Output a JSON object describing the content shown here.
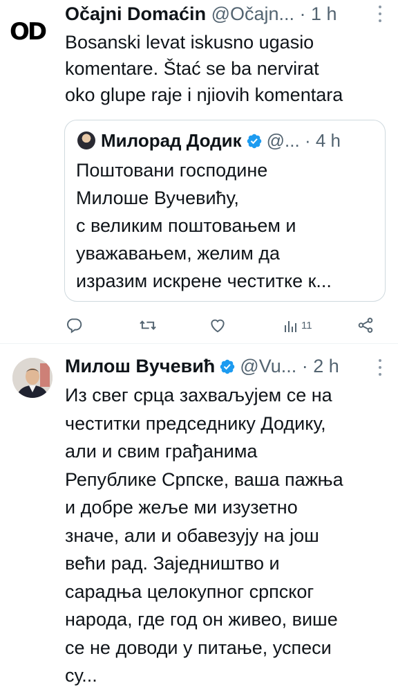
{
  "tweet1": {
    "avatar_text": "OD",
    "display_name": "Očajni Domaćin",
    "handle": "@Očajn...",
    "time": "· 1 h",
    "text": "Bosanski levat iskusno ugasio\nkomentare. Štać se ba nervirat\noko glupe raje i njiovih komentara",
    "quote": {
      "display_name": "Милорад Додик",
      "handle": "@...",
      "time": "· 4 h",
      "text": "Поштовани господине\nМилоше Вучевићу,\nс великим поштовањем и\nуважавањем, желим да\nизразим искрене честитке к..."
    },
    "actions": {
      "views_count": "11"
    }
  },
  "tweet2": {
    "display_name": "Милош Вучевић",
    "handle": "@Vu...",
    "time": "· 2 h",
    "text": "Из свег срца захваљујем се на\nчеститки председнику Додику,\nали и свим грађанима\nРепублике Српске, ваша пажња\nи добре жеље ми изузетно\nзначе, али и обавезују на још\nвећи рад. Заједништво и\nсарадња целокупног српског\nнарода, где год он живео, више\nсе не доводи у питање, успеси\nсу..."
  },
  "colors": {
    "text": "#0f1419",
    "muted": "#536471",
    "verified": "#1d9bf0",
    "border": "#cfd9de"
  }
}
